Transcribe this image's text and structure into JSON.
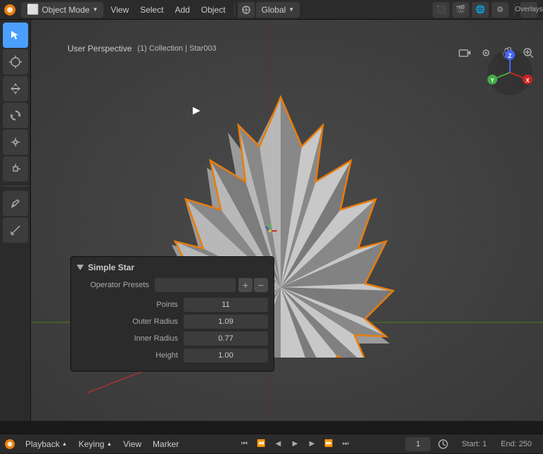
{
  "topbar": {
    "mode_label": "Object Mode",
    "view_label": "View",
    "select_label": "Select",
    "add_label": "Add",
    "object_label": "Object",
    "transform_label": "Global",
    "overlays_label": "Overlays"
  },
  "viewport": {
    "view_info": "User Perspective",
    "collection_info": "(1) Collection | Star003"
  },
  "operator": {
    "title": "Simple Star",
    "presets_label": "Operator Presets",
    "presets_placeholder": "",
    "fields": [
      {
        "label": "Points",
        "value": "11"
      },
      {
        "label": "Outer Radius",
        "value": "1.09"
      },
      {
        "label": "Inner Radius",
        "value": "0.77"
      },
      {
        "label": "Height",
        "value": "1.00"
      }
    ]
  },
  "bottombar": {
    "playback_label": "Playback",
    "keying_label": "Keying",
    "view_label": "View",
    "marker_label": "Marker",
    "current_frame": "1",
    "start_label": "Start:",
    "start_value": "1",
    "end_label": "End:",
    "end_value": "250"
  },
  "axis_gizmo": {
    "x_label": "X",
    "y_label": "Y",
    "z_label": "Z"
  }
}
